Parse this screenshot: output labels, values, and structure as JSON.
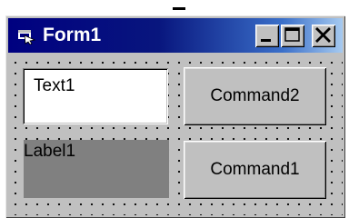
{
  "window": {
    "title": "Form1",
    "icon": "form-icon",
    "title_buttons": [
      "minimize-icon",
      "maximize-icon",
      "close-icon"
    ]
  },
  "form": {
    "textbox_value": "Text1",
    "label_text": "Label1",
    "command2_label": "Command2",
    "command1_label": "Command1"
  },
  "colors": {
    "titlebar_start": "#000080",
    "titlebar_end": "#a6caf0",
    "face": "#c0c0c0",
    "label_background": "#808080"
  }
}
